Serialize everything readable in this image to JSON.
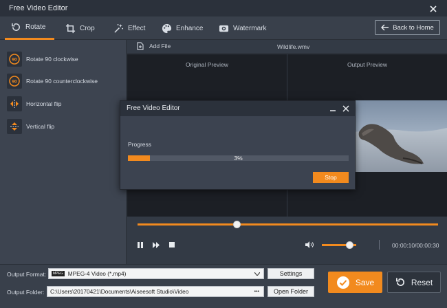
{
  "window": {
    "title": "Free Video Editor"
  },
  "toolbar": {
    "tabs": [
      {
        "label": "Rotate",
        "icon": "rotate-icon"
      },
      {
        "label": "Crop",
        "icon": "crop-icon"
      },
      {
        "label": "Effect",
        "icon": "effect-icon"
      },
      {
        "label": "Enhance",
        "icon": "palette-icon"
      },
      {
        "label": "Watermark",
        "icon": "watermark-icon"
      }
    ],
    "back_label": "Back to Home"
  },
  "sidebar": {
    "items": [
      {
        "label": "Rotate 90 clockwise",
        "icon": "rotate-cw-icon",
        "glyph": "90"
      },
      {
        "label": "Rotate 90 counterclockwise",
        "icon": "rotate-ccw-icon",
        "glyph": "90"
      },
      {
        "label": "Horizontal flip",
        "icon": "horizontal-flip-icon"
      },
      {
        "label": "Vertical flip",
        "icon": "vertical-flip-icon"
      }
    ]
  },
  "filebar": {
    "add_label": "Add File",
    "filename": "Wildlife.wmv"
  },
  "preview": {
    "original_label": "Original Preview",
    "output_label": "Output Preview"
  },
  "player": {
    "timecode": "00:00:10/00:00:30",
    "seek_position": 0.33,
    "volume": 0.8
  },
  "output": {
    "format_label": "Output Format:",
    "format_badge": "MPEG",
    "format_value": "MPEG-4 Video (*.mp4)",
    "settings_label": "Settings",
    "folder_label": "Output Folder:",
    "folder_value": "C:\\Users\\20170421\\Documents\\Aiseesoft Studio\\Video",
    "folder_more": "•••",
    "open_folder_label": "Open Folder"
  },
  "actions": {
    "save_label": "Save",
    "reset_label": "Reset"
  },
  "dialog": {
    "title": "Free Video Editor",
    "progress_label": "Progress",
    "progress_text": "3%",
    "progress_value": 0.03,
    "stop_label": "Stop"
  },
  "colors": {
    "accent": "#f28a1e",
    "background": "#333a45",
    "titlebar": "#2b313b",
    "preview_bg": "#1c1f25"
  }
}
